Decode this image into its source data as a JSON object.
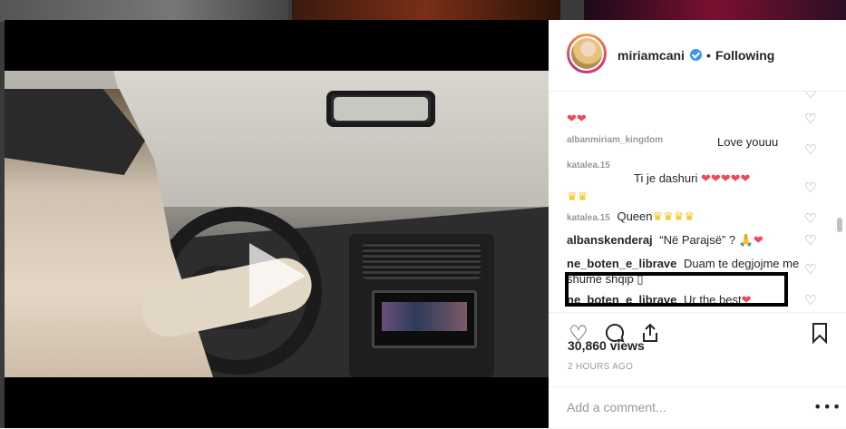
{
  "post": {
    "username": "miriamcani",
    "separator": "•",
    "follow_status": "Following"
  },
  "comments": [
    {
      "user": "",
      "text": "",
      "emoji": "❤❤"
    },
    {
      "user": "",
      "text": "Love youuu",
      "emoji": ""
    },
    {
      "user": "",
      "text": "Ti je dashuri",
      "emoji": "❤❤❤❤❤"
    },
    {
      "user": "",
      "text": "",
      "emoji": "♛♛"
    },
    {
      "user": "",
      "text": "Queen",
      "emoji": "♛♛♛♛"
    },
    {
      "user": "albanskenderaj",
      "text": "“Në Parajsë” ?",
      "emoji": "🙏❤"
    },
    {
      "user": "ne_boten_e_librave",
      "text": "Duam te degjojme me shume shqip",
      "emoji": "▯"
    },
    {
      "user": "ne_boten_e_librave",
      "text": "Ur the best",
      "emoji": "❤"
    }
  ],
  "faded_users": [
    "albanmiriam_kingdom",
    "katalea.15",
    "katalea.15"
  ],
  "stats": {
    "views": "30,860 views",
    "time_ago": "2 HOURS AGO"
  },
  "comment_box": {
    "placeholder": "Add a comment..."
  },
  "icons": {
    "like": "heart-outline-icon",
    "comment": "speech-bubble-icon",
    "share": "share-icon",
    "save": "bookmark-icon",
    "more": "ellipsis-icon",
    "play": "play-icon",
    "verified": "verified-badge-icon"
  },
  "colors": {
    "heart": "#ed4956",
    "verified": "#3897f0",
    "crown": "#f2c40f"
  }
}
